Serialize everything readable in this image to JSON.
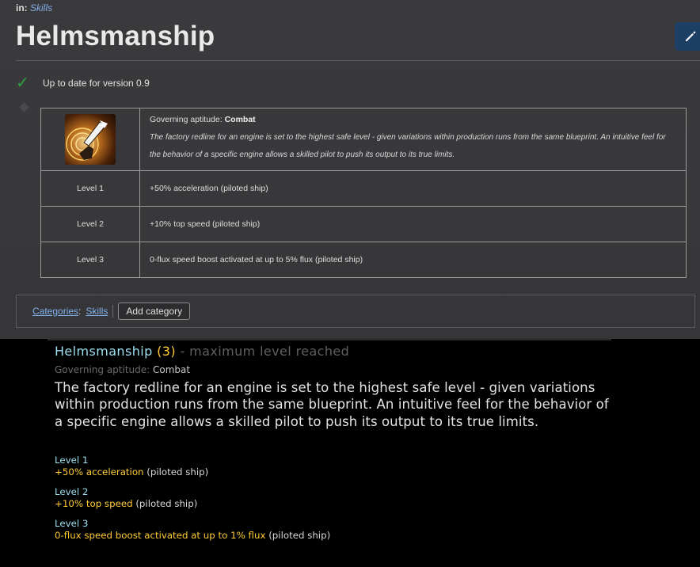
{
  "breadcrumb": {
    "prefix": "in:",
    "link": "Skills"
  },
  "page": {
    "title": "Helmsmanship"
  },
  "status": {
    "text": "Up to date for version 0.9"
  },
  "skill_table": {
    "governing_label": "Governing aptitude:",
    "governing_value": "Combat",
    "description": "The factory redline for an engine is set to the highest safe level - given variations within production runs from the same blueprint. An intuitive feel for the behavior of a specific engine allows a skilled pilot to push its output to its true limits.",
    "rows": [
      {
        "level": "Level 1",
        "effect": "+50% acceleration (piloted ship)"
      },
      {
        "level": "Level 2",
        "effect": "+10% top speed (piloted ship)"
      },
      {
        "level": "Level 3",
        "effect": "0-flux speed boost activated at up to 5% flux (piloted ship)"
      }
    ]
  },
  "categories": {
    "label": "Categories",
    "colon": ":",
    "items": [
      "Skills"
    ],
    "add_button": "Add category"
  },
  "tooltip": {
    "name": "Helmsmanship",
    "level": "(3)",
    "max_text": " - maximum level reached",
    "governing_label": "Governing aptitude:",
    "governing_value": "Combat",
    "description": "The factory redline for an engine is set to the highest safe level - given variations within production runs from the same blueprint. An intuitive feel for the behavior of a specific engine allows a skilled pilot to push its output to its true limits.",
    "levels": [
      {
        "title": "Level 1",
        "highlight": "+50% acceleration",
        "rest": " (piloted ship)"
      },
      {
        "title": "Level 2",
        "highlight": "+10% top speed",
        "rest": " (piloted ship)"
      },
      {
        "title": "Level 3",
        "highlight": "0-flux speed boost activated at up to 1% flux",
        "rest": " (piloted ship)"
      }
    ]
  },
  "colors": {
    "link": "#7fb0ea",
    "check": "#2ea043",
    "edit_button": "#1d3f66",
    "tooltip_title": "#9edff0",
    "tooltip_highlight": "#ffcc33"
  },
  "icons": {
    "edit": "pencil-icon",
    "status": "checkmark-icon",
    "skill": "helmsmanship-skill-icon"
  }
}
